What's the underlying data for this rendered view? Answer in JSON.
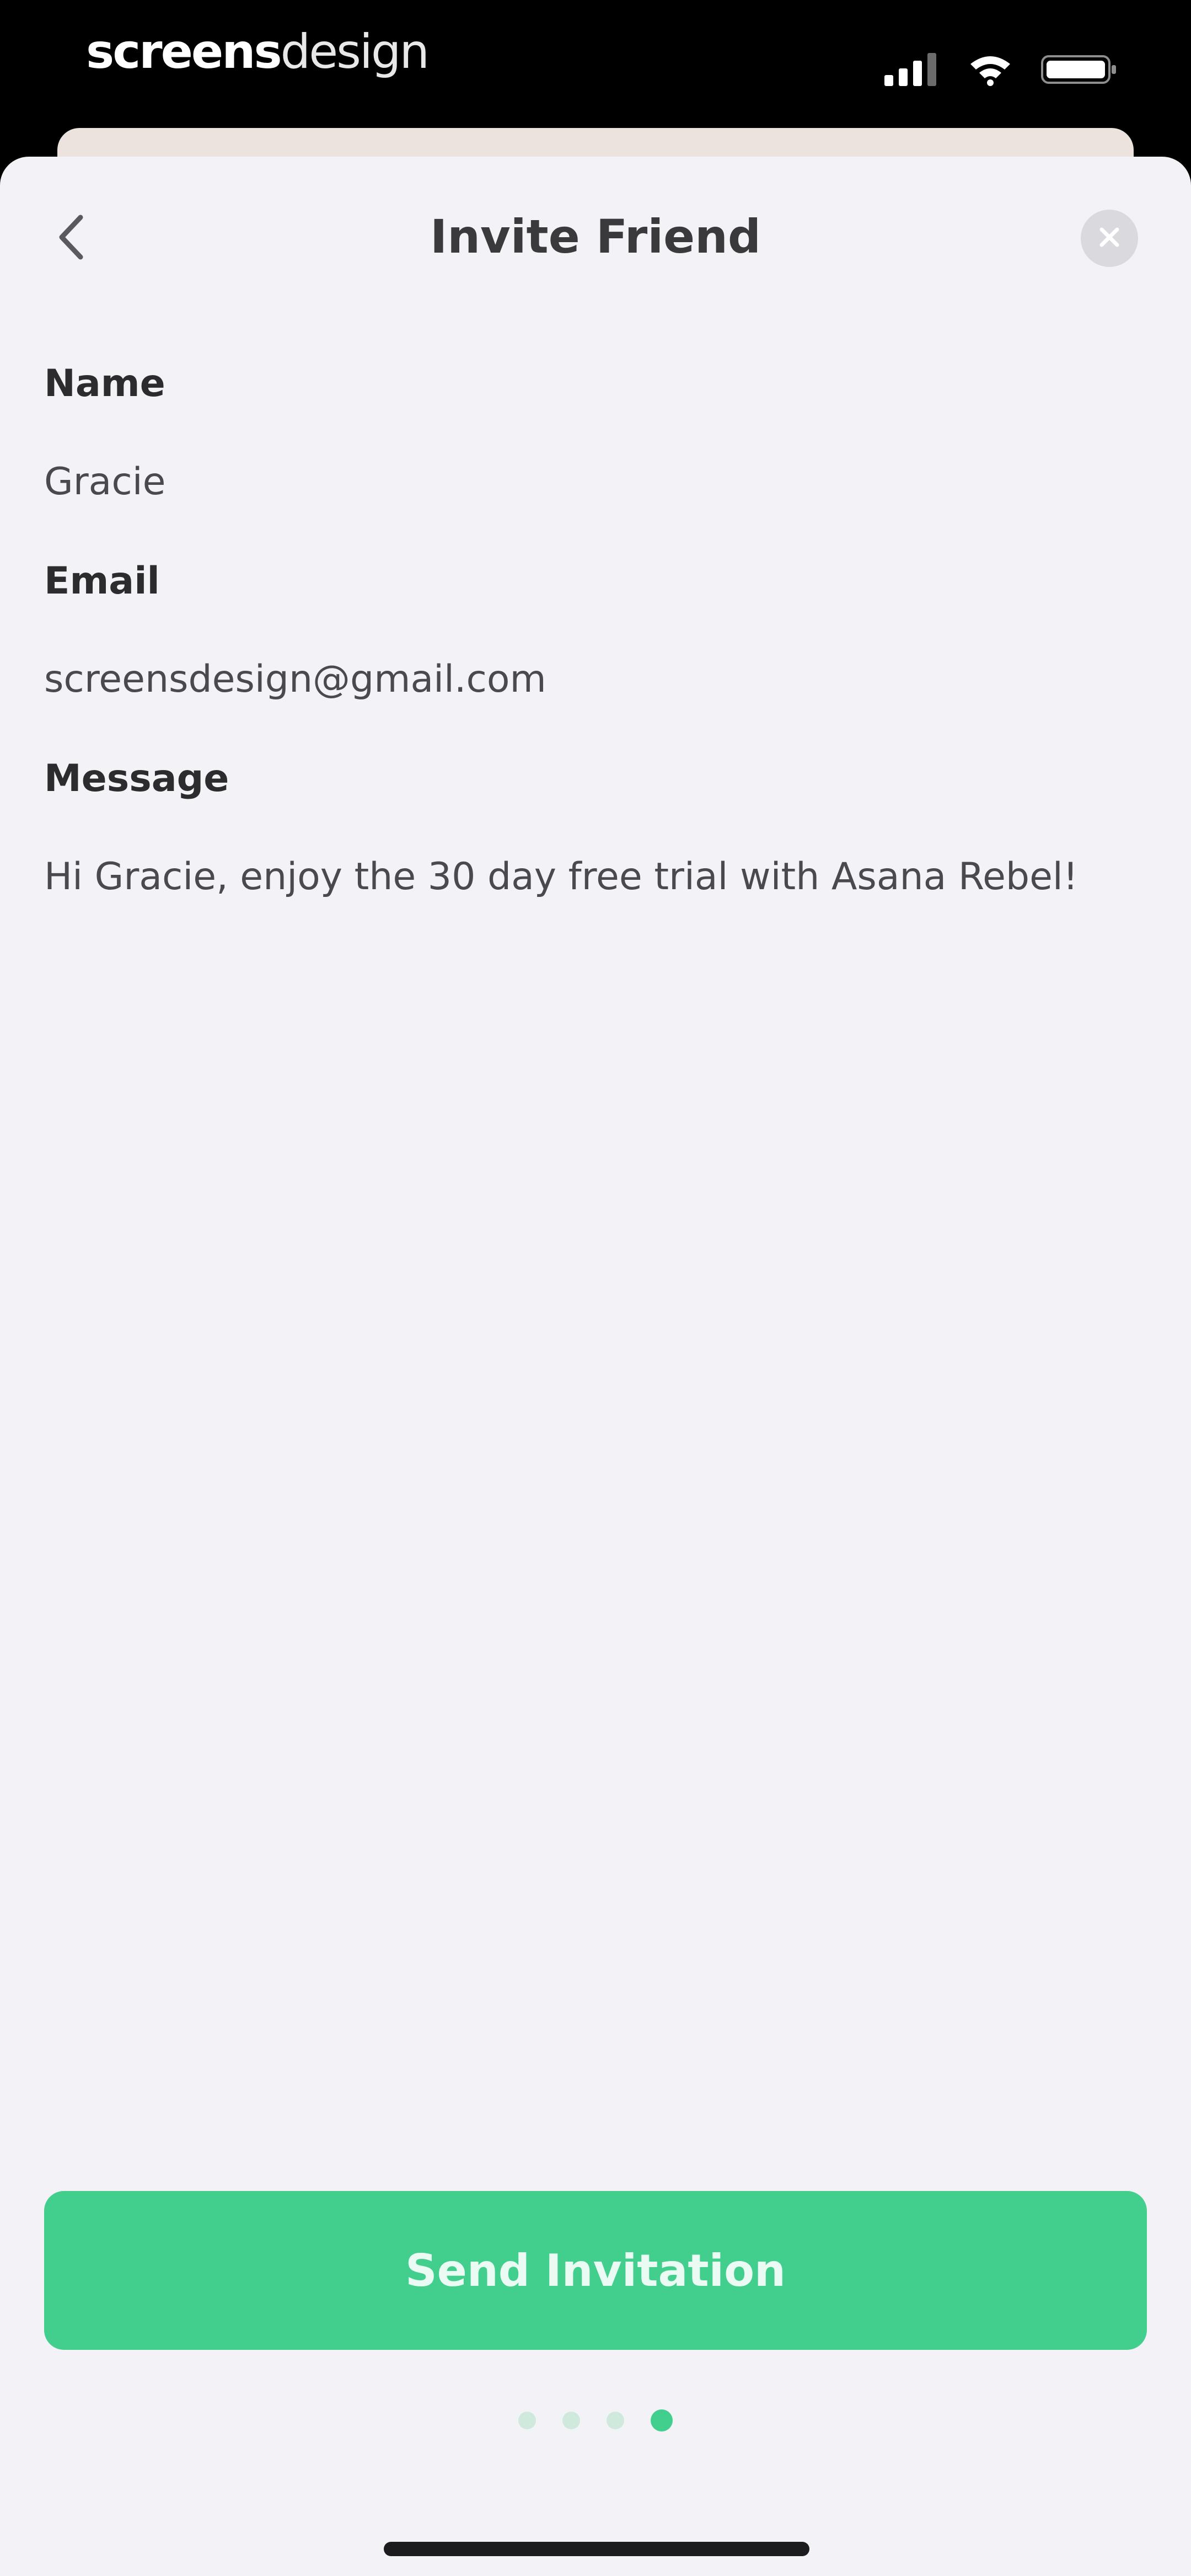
{
  "status_bar": {
    "brand_bold": "screens",
    "brand_light": "design",
    "icons": [
      "signal-icon",
      "wifi-icon",
      "battery-icon"
    ]
  },
  "header": {
    "title": "Invite Friend",
    "back_icon": "chevron-left-icon",
    "close_icon": "close-circle-icon"
  },
  "form": {
    "name_label": "Name",
    "name_value": "Gracie",
    "email_label": "Email",
    "email_value": "screensdesign@gmail.com",
    "message_label": "Message",
    "message_value": "Hi Gracie, enjoy the 30 day free trial with Asana Rebel!"
  },
  "actions": {
    "send_label": "Send Invitation"
  },
  "pager": {
    "total": 4,
    "active_index": 3
  },
  "colors": {
    "accent": "#42cf8e",
    "sheet_background": "#f2f2f7",
    "text_primary": "#2c2c2e"
  }
}
